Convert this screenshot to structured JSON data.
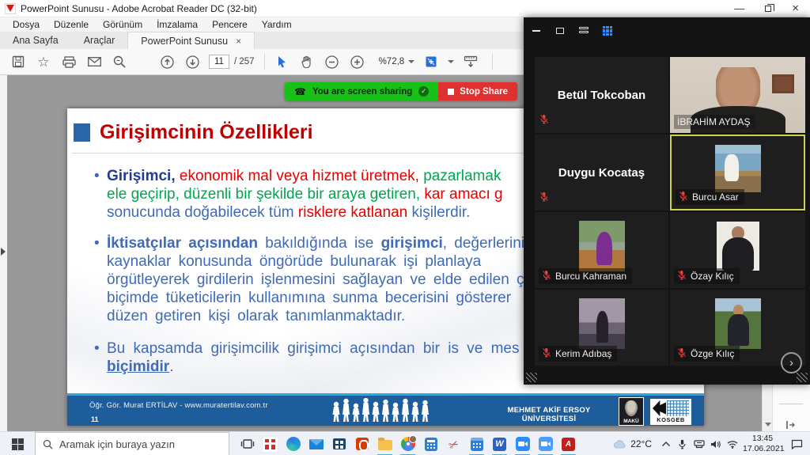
{
  "window": {
    "title": "PowerPoint Sunusu - Adobe Acrobat Reader DC (32-bit)"
  },
  "menu_bar": {
    "items": [
      "Dosya",
      "Düzenle",
      "Görünüm",
      "İmzalama",
      "Pencere",
      "Yardım"
    ]
  },
  "tab_bar": {
    "tabs": [
      {
        "label": "Ana Sayfa",
        "active": false
      },
      {
        "label": "Araçlar",
        "active": false
      },
      {
        "label": "PowerPoint Sunusu",
        "active": true,
        "closable": true
      }
    ]
  },
  "toolbar": {
    "icons_left": [
      "save",
      "star",
      "print",
      "email",
      "search"
    ],
    "page_current": "11",
    "page_total": "/ 257",
    "icons_mid": [
      "select-arrow",
      "hand",
      "zoom-out",
      "zoom-in"
    ],
    "zoom_level": "%72,8",
    "icons_right": [
      "page-fit",
      "ruler"
    ]
  },
  "share_bar": {
    "message": "You are screen sharing",
    "stop_label": "Stop Share",
    "green": "#17c117",
    "red": "#e03131"
  },
  "slide": {
    "title": "Girişimcinin Özellikleri",
    "colors": {
      "title": "#c00000",
      "navy": "#1f3c94",
      "red": "#e60000",
      "green": "#00a650",
      "blue": "#3f6ab5"
    },
    "bullets": [
      {
        "lines": [
          [
            {
              "t": "Girişimci,",
              "c": "navy",
              "b": true
            },
            {
              "t": " ekonomik mal veya hizmet üretmek,",
              "c": "red"
            },
            {
              "t": " pazarlamak",
              "c": "green"
            }
          ],
          [
            {
              "t": "ele geçirip, düzenli bir şekilde bir araya getiren,",
              "c": "green"
            },
            {
              "t": " kar amacı g",
              "c": "red"
            }
          ],
          [
            {
              "t": "sonucunda doğabilecek tüm ",
              "c": "blue"
            },
            {
              "t": "risklere katlanan",
              "c": "red"
            },
            {
              "t": " kişilerdir.",
              "c": "blue"
            }
          ]
        ]
      },
      {
        "lines": [
          [
            {
              "t": "İktisatçılar açısından",
              "c": "blue",
              "b": true
            },
            {
              "t": " bakıldığında ise ",
              "c": "blue"
            },
            {
              "t": "girişimci",
              "c": "blue",
              "b": true
            },
            {
              "t": ", değerlerini f",
              "c": "blue"
            }
          ],
          [
            {
              "t": "kaynaklar konusunda öngörüde bulunarak işi planlaya",
              "c": "blue"
            }
          ],
          [
            {
              "t": "örgütleyerek girdilerin işlenmesini sağlayan ve elde edilen ç",
              "c": "blue"
            }
          ],
          [
            {
              "t": "biçimde tüketicilerin kullanımına sunma becerisini gösterer",
              "c": "blue"
            }
          ],
          [
            {
              "t": "düzen getiren kişi olarak tanımlanmaktadır.",
              "c": "blue"
            }
          ]
        ]
      },
      {
        "lines": [
          [
            {
              "t": "Bu kapsamda girişimcilik girişimci açısından bir is ve mes",
              "c": "blue"
            }
          ],
          [
            {
              "t": "biçimidir",
              "c": "blue",
              "b": true,
              "u": true
            },
            {
              "t": ".",
              "c": "blue"
            }
          ]
        ]
      }
    ],
    "footer": {
      "credit": "Öğr. Gör. Murat ERTİLAV  -  www.muratertilav.com.tr",
      "page_number": "11",
      "university": "MEHMET AKİF ERSOY ÜNİVERSİTESİ",
      "maku_label": "MAKÜ",
      "kosgeb_label": "KOSGEB"
    }
  },
  "meeting_panel": {
    "top_icons": [
      "minimize",
      "window",
      "speaker-view",
      "gallery-view"
    ],
    "active_border": "#ccd24d",
    "participants": [
      {
        "name": "Betül Tokcoban",
        "video": false,
        "muted": true,
        "photo": ""
      },
      {
        "name": "İBRAHİM AYDAŞ",
        "video": true,
        "muted": false,
        "photo": "ph-full"
      },
      {
        "name": "Duygu Kocataş",
        "video": false,
        "muted": true,
        "photo": ""
      },
      {
        "name": "Burcu Asar",
        "video": true,
        "muted": true,
        "active": true,
        "photo": "ph-dock"
      },
      {
        "name": "Burcu Kahraman",
        "video": true,
        "muted": true,
        "photo": "ph-river"
      },
      {
        "name": "Özay Kılıç",
        "video": true,
        "muted": true,
        "photo": "ph-hoodie"
      },
      {
        "name": "Kerim Adıbaş",
        "video": true,
        "muted": true,
        "photo": "ph-dusk"
      },
      {
        "name": "Özge Kılıç",
        "video": true,
        "muted": true,
        "photo": "ph-garden"
      }
    ]
  },
  "taskbar": {
    "search_placeholder": "Aramak için buraya yazın",
    "app_icons": [
      {
        "n": "task-view",
        "run": false
      },
      {
        "n": "gift",
        "run": false
      },
      {
        "n": "edge",
        "run": false
      },
      {
        "n": "mail",
        "run": false
      },
      {
        "n": "store",
        "run": false
      },
      {
        "n": "office",
        "run": false
      },
      {
        "n": "explorer",
        "run": true
      },
      {
        "n": "chrome",
        "run": true
      },
      {
        "n": "calculator",
        "run": false
      },
      {
        "n": "snip",
        "run": false
      },
      {
        "n": "calendar",
        "run": true
      },
      {
        "n": "word",
        "run": true
      },
      {
        "n": "camera",
        "run": true
      },
      {
        "n": "zoom",
        "run": true
      },
      {
        "n": "acrobat",
        "run": true
      }
    ],
    "tray": {
      "temperature": "22°C",
      "icons": [
        "chevron-up",
        "mic",
        "ethernet",
        "speaker",
        "wifi"
      ],
      "time": "13:45",
      "date": "17.06.2021"
    }
  }
}
